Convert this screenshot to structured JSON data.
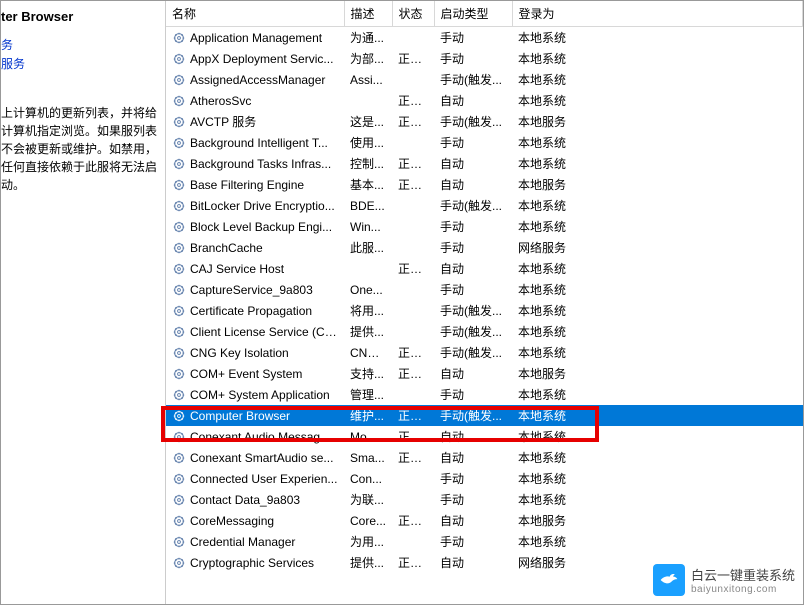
{
  "leftPane": {
    "title": "ter Browser",
    "link1": "务",
    "link2": "服务",
    "description": "上计算机的更新列表，并将给计算机指定浏览。如果服列表不会被更新或维护。如禁用，任何直接依赖于此服将无法启动。"
  },
  "columns": {
    "name": "名称",
    "desc": "描述",
    "status": "状态",
    "start": "启动类型",
    "logon": "登录为"
  },
  "rows": [
    {
      "name": "Application Management",
      "desc": "为通...",
      "status": "",
      "start": "手动",
      "logon": "本地系统"
    },
    {
      "name": "AppX Deployment Servic...",
      "desc": "为部...",
      "status": "正在...",
      "start": "手动",
      "logon": "本地系统"
    },
    {
      "name": "AssignedAccessManager",
      "desc": "Assi...",
      "status": "",
      "start": "手动(触发...",
      "logon": "本地系统"
    },
    {
      "name": "AtherosSvc",
      "desc": "",
      "status": "正在...",
      "start": "自动",
      "logon": "本地系统"
    },
    {
      "name": "AVCTP 服务",
      "desc": "这是...",
      "status": "正在...",
      "start": "手动(触发...",
      "logon": "本地服务"
    },
    {
      "name": "Background Intelligent T...",
      "desc": "使用...",
      "status": "",
      "start": "手动",
      "logon": "本地系统"
    },
    {
      "name": "Background Tasks Infras...",
      "desc": "控制...",
      "status": "正在...",
      "start": "自动",
      "logon": "本地系统"
    },
    {
      "name": "Base Filtering Engine",
      "desc": "基本...",
      "status": "正在...",
      "start": "自动",
      "logon": "本地服务"
    },
    {
      "name": "BitLocker Drive Encryptio...",
      "desc": "BDE...",
      "status": "",
      "start": "手动(触发...",
      "logon": "本地系统"
    },
    {
      "name": "Block Level Backup Engi...",
      "desc": "Win...",
      "status": "",
      "start": "手动",
      "logon": "本地系统"
    },
    {
      "name": "BranchCache",
      "desc": "此服...",
      "status": "",
      "start": "手动",
      "logon": "网络服务"
    },
    {
      "name": "CAJ Service Host",
      "desc": "",
      "status": "正在...",
      "start": "自动",
      "logon": "本地系统"
    },
    {
      "name": "CaptureService_9a803",
      "desc": "One...",
      "status": "",
      "start": "手动",
      "logon": "本地系统"
    },
    {
      "name": "Certificate Propagation",
      "desc": "将用...",
      "status": "",
      "start": "手动(触发...",
      "logon": "本地系统"
    },
    {
      "name": "Client License Service (Cli...",
      "desc": "提供...",
      "status": "",
      "start": "手动(触发...",
      "logon": "本地系统"
    },
    {
      "name": "CNG Key Isolation",
      "desc": "CNG...",
      "status": "正在...",
      "start": "手动(触发...",
      "logon": "本地系统"
    },
    {
      "name": "COM+ Event System",
      "desc": "支持...",
      "status": "正在...",
      "start": "自动",
      "logon": "本地服务"
    },
    {
      "name": "COM+ System Application",
      "desc": "管理...",
      "status": "",
      "start": "手动",
      "logon": "本地系统"
    },
    {
      "name": "Computer Browser",
      "desc": "维护...",
      "status": "正在...",
      "start": "手动(触发...",
      "logon": "本地系统",
      "selected": true
    },
    {
      "name": "Conexant Audio Messag...",
      "desc": "Mo...",
      "status": "正在...",
      "start": "自动",
      "logon": "本地系统"
    },
    {
      "name": "Conexant SmartAudio se...",
      "desc": "Sma...",
      "status": "正在...",
      "start": "自动",
      "logon": "本地系统"
    },
    {
      "name": "Connected User Experien...",
      "desc": "Con...",
      "status": "",
      "start": "手动",
      "logon": "本地系统"
    },
    {
      "name": "Contact Data_9a803",
      "desc": "为联...",
      "status": "",
      "start": "手动",
      "logon": "本地系统"
    },
    {
      "name": "CoreMessaging",
      "desc": "Core...",
      "status": "正在...",
      "start": "自动",
      "logon": "本地服务"
    },
    {
      "name": "Credential Manager",
      "desc": "为用...",
      "status": "",
      "start": "手动",
      "logon": "本地系统"
    },
    {
      "name": "Cryptographic Services",
      "desc": "提供...",
      "status": "正在...",
      "start": "自动",
      "logon": "网络服务"
    }
  ],
  "watermark": {
    "cn": "白云一键重装系统",
    "en": "baiyunxitong.com"
  }
}
